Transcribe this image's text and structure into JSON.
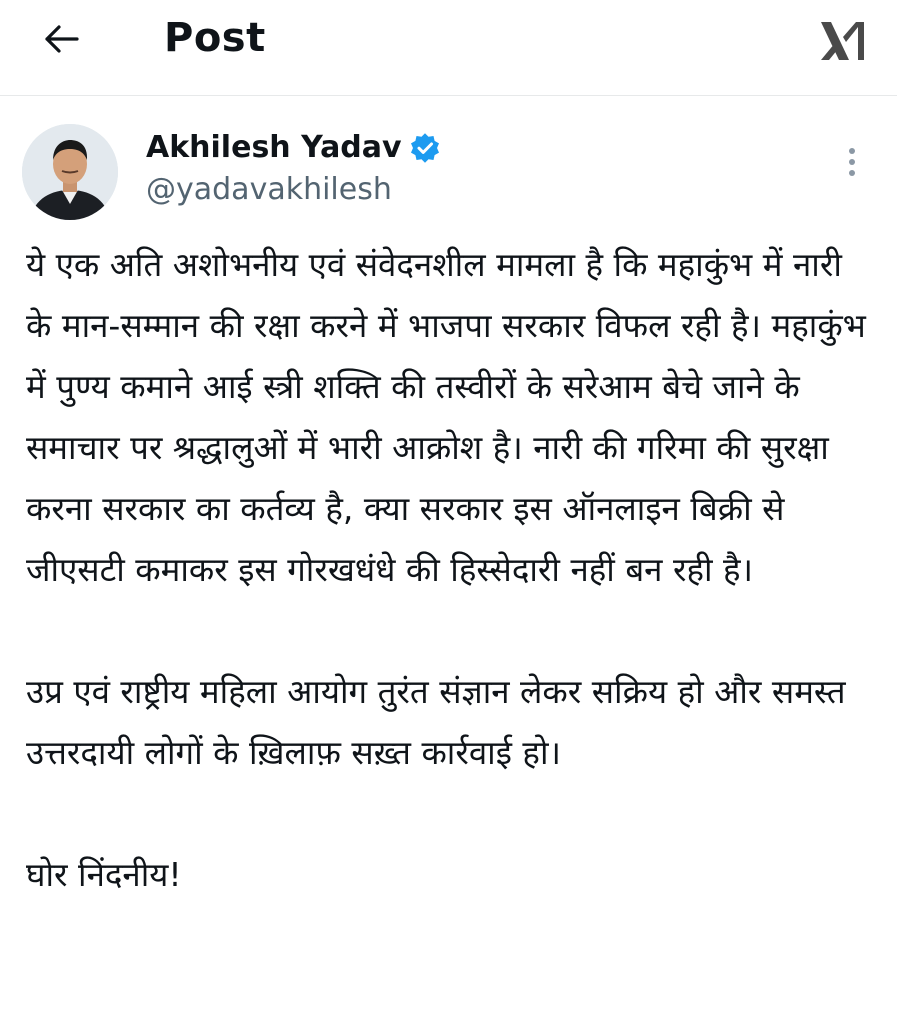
{
  "header": {
    "title": "Post",
    "back_icon": "arrow-left-icon",
    "logo_icon": "x-logo-icon"
  },
  "author": {
    "name": "Akhilesh Yadav",
    "handle": "@yadavakhilesh",
    "verified": true,
    "verified_color": "#1d9bf0",
    "more_icon": "more-vertical-icon"
  },
  "post": {
    "paragraphs": [
      "ये एक अति अशोभनीय एवं संवेदनशील मामला है कि महाकुंभ में नारी के मान-सम्मान की रक्षा करने में भाजपा सरकार विफल रही है। महाकुंभ में पुण्य कमाने आई स्त्री शक्ति की तस्वीरों के सरेआम बेचे जाने के समाचार पर श्रद्धालुओं में भारी आक्रोश है। नारी की गरिमा की सुरक्षा करना सरकार का कर्तव्य है, क्या सरकार इस ऑनलाइन बिक्री से जीएसटी कमाकर इस गोरखधंधे की हिस्सेदारी नहीं बन रही है।",
      "उप्र एवं राष्ट्रीय महिला आयोग तुरंत संज्ञान लेकर सक्रिय हो और समस्त उत्तरदायी लोगों के ख़िलाफ़ सख़्त कार्रवाई हो।",
      "घोर निंदनीय!"
    ]
  }
}
